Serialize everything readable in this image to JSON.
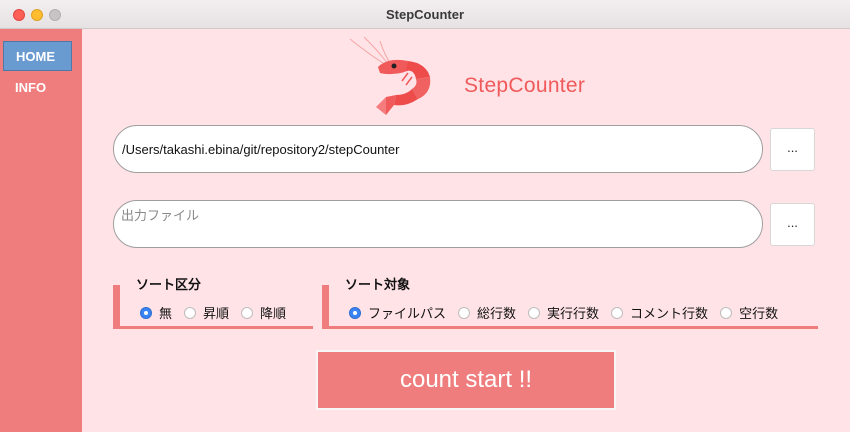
{
  "window": {
    "title": "StepCounter"
  },
  "sidebar": {
    "items": [
      {
        "label": "HOME",
        "selected": true
      },
      {
        "label": "INFO",
        "selected": false
      }
    ]
  },
  "logo": {
    "text": "StepCounter",
    "icon": "shrimp-icon"
  },
  "inputs": {
    "path_value": "/Users/takashi.ebina/git/repository2/stepCounter",
    "output_placeholder": "出力ファイル",
    "browse_label": "..."
  },
  "sort_division": {
    "title": "ソート区分",
    "options": [
      "無",
      "昇順",
      "降順"
    ],
    "selected": "無"
  },
  "sort_target": {
    "title": "ソート対象",
    "options": [
      "ファイルパス",
      "総行数",
      "実行行数",
      "コメント行数",
      "空行数"
    ],
    "selected": "ファイルパス"
  },
  "start_button": {
    "label": "count start !!"
  },
  "colors": {
    "accent": "#f07d7d",
    "background": "#ffe3e7",
    "selected_nav": "#6a9bd0",
    "radio_selected": "#3a84f3"
  }
}
